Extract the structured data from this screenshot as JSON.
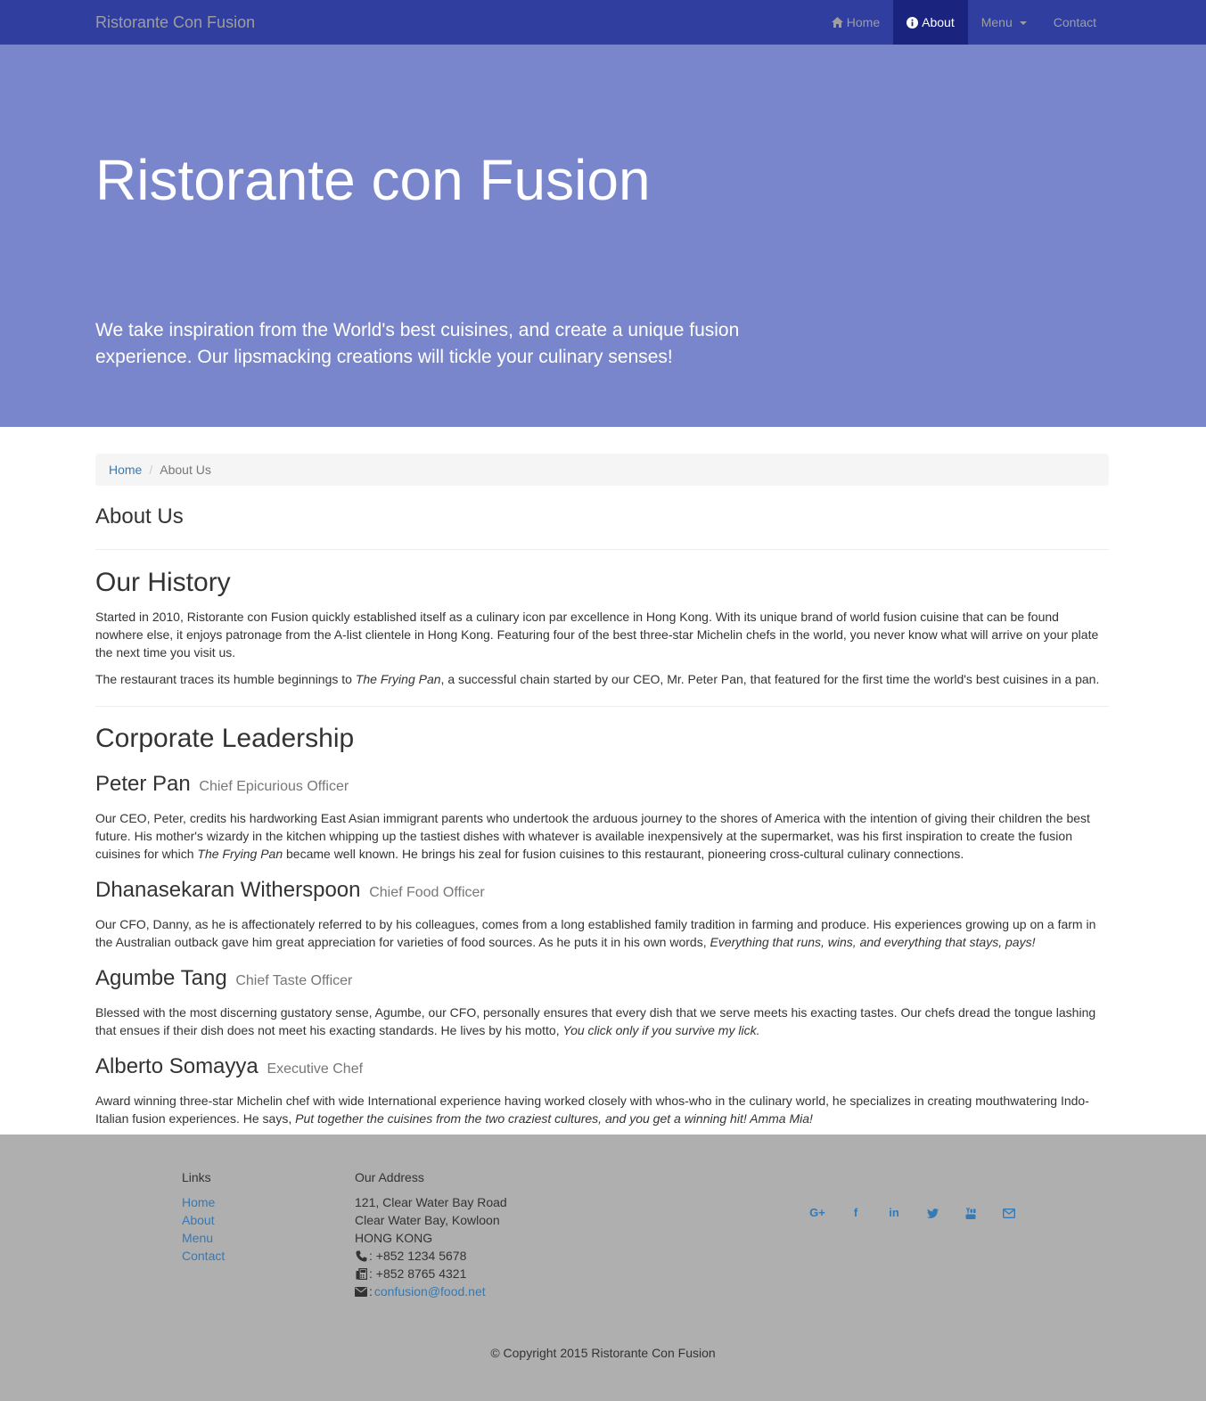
{
  "navbar": {
    "brand": "Ristorante Con Fusion",
    "items": [
      {
        "label": "Home"
      },
      {
        "label": "About"
      },
      {
        "label": "Menu"
      },
      {
        "label": "Contact"
      }
    ]
  },
  "jumbotron": {
    "title": "Ristorante con Fusion",
    "tagline": "We take inspiration from the World's best cuisines, and create a unique fusion experience. Our lipsmacking creations will tickle your culinary senses!"
  },
  "breadcrumb": {
    "home": "Home",
    "separator": "/",
    "current": "About Us"
  },
  "page_title": "About Us",
  "history": {
    "title": "Our History",
    "p1": "Started in 2010, Ristorante con Fusion quickly established itself as a culinary icon par excellence in Hong Kong. With its unique brand of world fusion cuisine that can be found nowhere else, it enjoys patronage from the A-list clientele in Hong Kong. Featuring four of the best three-star Michelin chefs in the world, you never know what will arrive on your plate the next time you visit us.",
    "p2_before": "The restaurant traces its humble beginnings to ",
    "p2_italic": "The Frying Pan",
    "p2_after": ", a successful chain started by our CEO, Mr. Peter Pan, that featured for the first time the world's best cuisines in a pan."
  },
  "leadership": {
    "title": "Corporate Leadership",
    "leaders": [
      {
        "name": "Peter Pan",
        "role": "Chief Epicurious Officer",
        "bio_before": "Our CEO, Peter, credits his hardworking East Asian immigrant parents who undertook the arduous journey to the shores of America with the intention of giving their children the best future. His mother's wizardy in the kitchen whipping up the tastiest dishes with whatever is available inexpensively at the supermarket, was his first inspiration to create the fusion cuisines for which ",
        "bio_italic": "The Frying Pan",
        "bio_after": " became well known. He brings his zeal for fusion cuisines to this restaurant, pioneering cross-cultural culinary connections."
      },
      {
        "name": "Dhanasekaran Witherspoon",
        "role": "Chief Food Officer",
        "bio_before": "Our CFO, Danny, as he is affectionately referred to by his colleagues, comes from a long established family tradition in farming and produce. His experiences growing up on a farm in the Australian outback gave him great appreciation for varieties of food sources. As he puts it in his own words, ",
        "bio_italic": "Everything that runs, wins, and everything that stays, pays!",
        "bio_after": ""
      },
      {
        "name": "Agumbe Tang",
        "role": "Chief Taste Officer",
        "bio_before": "Blessed with the most discerning gustatory sense, Agumbe, our CFO, personally ensures that every dish that we serve meets his exacting tastes. Our chefs dread the tongue lashing that ensues if their dish does not meet his exacting standards. He lives by his motto, ",
        "bio_italic": "You click only if you survive my lick.",
        "bio_after": ""
      },
      {
        "name": "Alberto Somayya",
        "role": "Executive Chef",
        "bio_before": "Award winning three-star Michelin chef with wide International experience having worked closely with whos-who in the culinary world, he specializes in creating mouthwatering Indo-Italian fusion experiences. He says, ",
        "bio_italic": "Put together the cuisines from the two craziest cultures, and you get a winning hit! Amma Mia!",
        "bio_after": ""
      }
    ]
  },
  "footer": {
    "links_title": "Links",
    "links": [
      "Home",
      "About",
      "Menu",
      "Contact"
    ],
    "address_title": "Our Address",
    "address_lines": [
      "121, Clear Water Bay Road",
      "Clear Water Bay, Kowloon",
      "HONG KONG"
    ],
    "phone": ": +852 1234 5678",
    "fax": ": +852 8765 4321",
    "email_prefix": ": ",
    "email": "confusion@food.net",
    "social_icons": [
      "google-plus-icon",
      "facebook-icon",
      "linkedin-icon",
      "twitter-icon",
      "youtube-icon",
      "mail-icon"
    ],
    "copyright": "© Copyright 2015 Ristorante Con Fusion"
  },
  "colors": {
    "navbar_bg": "#303f9f",
    "nav_active_bg": "#1a237e",
    "jumbotron_bg": "#7986cb",
    "footer_bg": "#afafaf",
    "link": "#337ab7"
  }
}
